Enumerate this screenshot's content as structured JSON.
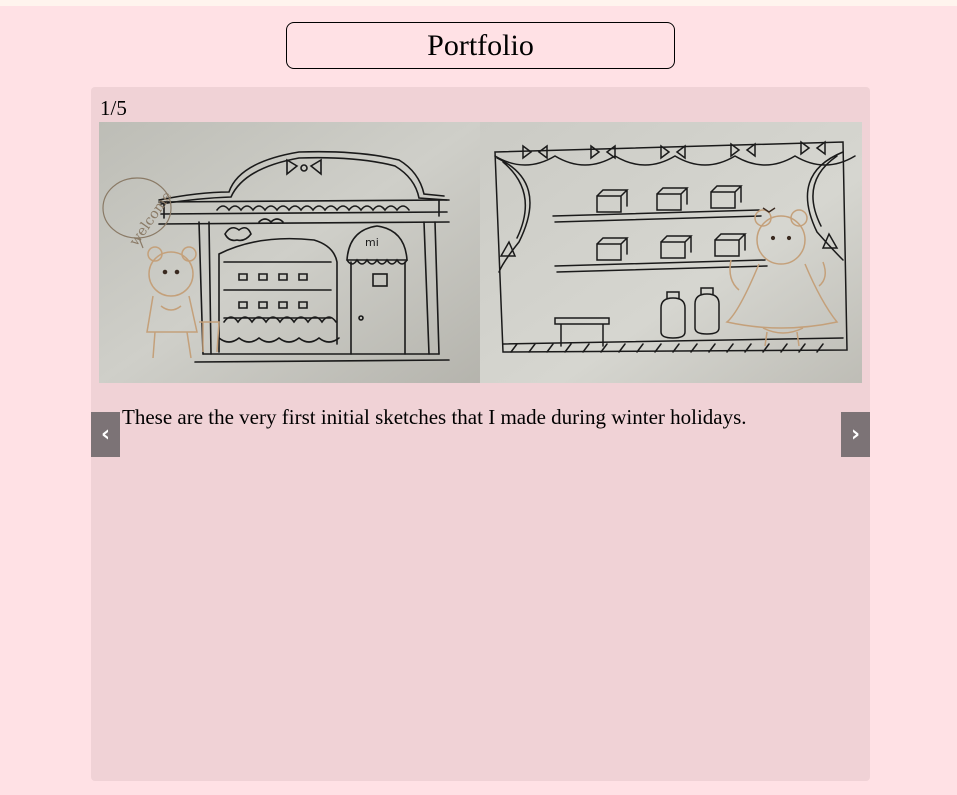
{
  "page": {
    "title": "Portfolio"
  },
  "slideshow": {
    "counter": "1/5",
    "caption": "These are the very first initial sketches that I made during winter holidays.",
    "prev_icon": "‹",
    "next_icon": "›",
    "image": {
      "left_panel": "pencil sketch of shop front with bear character and 'welcome' speech bubble",
      "right_panel": "pencil sketch of shop interior with shelves, bows and bear character"
    }
  },
  "colors": {
    "page_bg": "#ffe1e5",
    "panel_bg": "#f0d2d6",
    "nav_bg": "#7c7376",
    "paper": "#c8c8c2",
    "bear_tan": "#c4a07a"
  }
}
